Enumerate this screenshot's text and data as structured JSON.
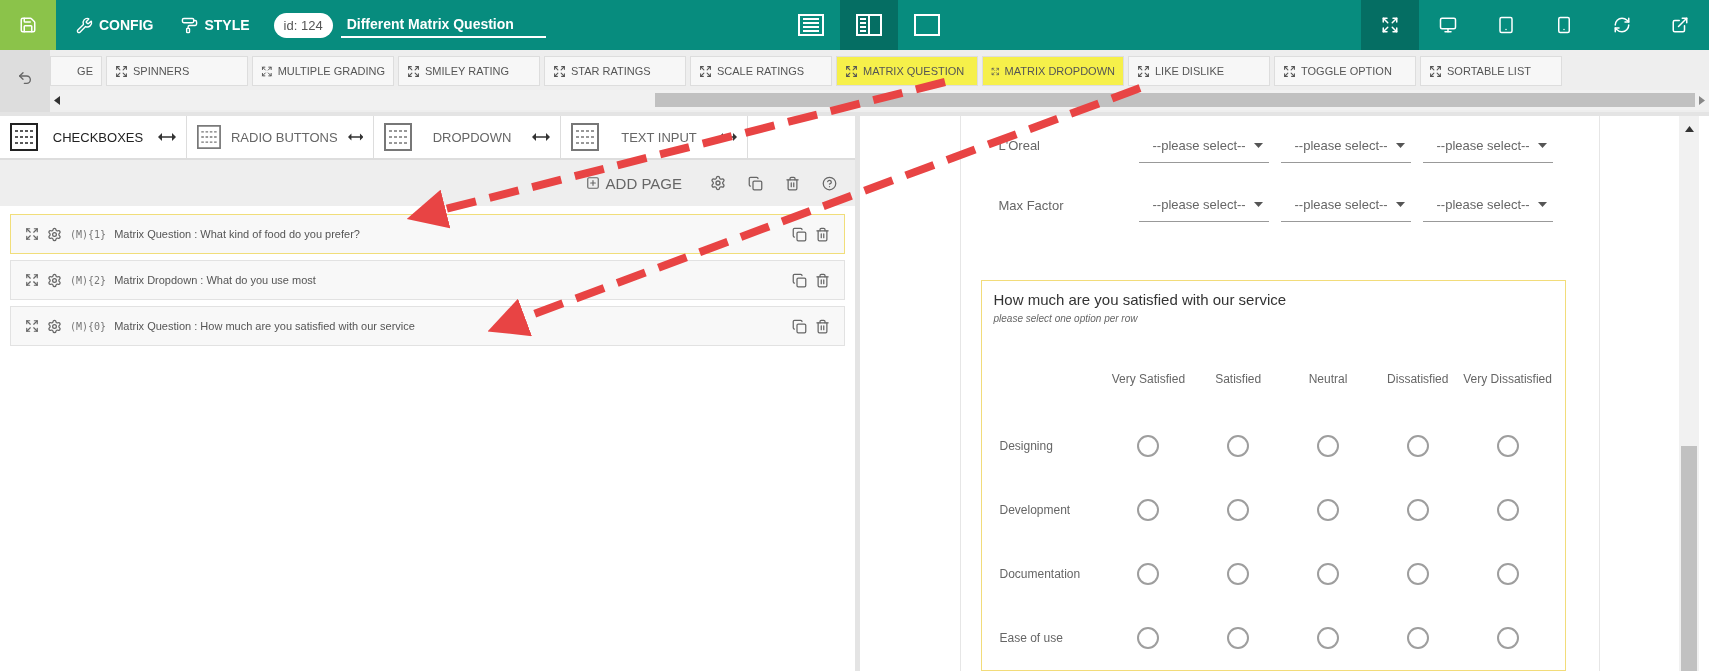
{
  "topbar": {
    "config": "CONFIG",
    "style": "STYLE",
    "id_badge": "id: 124",
    "title_value": "Different Matrix Question",
    "view_modes": [
      {
        "kind": "list",
        "selected": false
      },
      {
        "kind": "split",
        "selected": true
      },
      {
        "kind": "preview",
        "selected": false
      }
    ],
    "device_modes": [
      {
        "kind": "fullscreen",
        "selected": true
      },
      {
        "kind": "desktop",
        "selected": false
      },
      {
        "kind": "tablet",
        "selected": false
      },
      {
        "kind": "phone",
        "selected": false
      }
    ]
  },
  "palette": {
    "items": [
      {
        "label": "GE",
        "highlighted": false
      },
      {
        "label": "SPINNERS",
        "highlighted": false
      },
      {
        "label": "MULTIPLE GRADING",
        "highlighted": false
      },
      {
        "label": "SMILEY RATING",
        "highlighted": false
      },
      {
        "label": "STAR RATINGS",
        "highlighted": false
      },
      {
        "label": "SCALE RATINGS",
        "highlighted": false
      },
      {
        "label": "MATRIX QUESTION",
        "highlighted": true
      },
      {
        "label": "MATRIX DROPDOWN",
        "highlighted": true
      },
      {
        "label": "LIKE DISLIKE",
        "highlighted": false
      },
      {
        "label": "TOGGLE OPTION",
        "highlighted": false
      },
      {
        "label": "SORTABLE LIST",
        "highlighted": false
      }
    ]
  },
  "builder_tabs": [
    {
      "label": "CHECKBOXES",
      "selected": true
    },
    {
      "label": "RADIO BUTTONS",
      "selected": false
    },
    {
      "label": "DROPDOWN",
      "selected": false
    },
    {
      "label": "TEXT INPUT",
      "selected": false
    }
  ],
  "page_toolbar": {
    "add_page": "ADD PAGE"
  },
  "questions": [
    {
      "code": "(M){1}",
      "text": "Matrix Question : What kind of food do you prefer?",
      "selected": true
    },
    {
      "code": "(M){2}",
      "text": "Matrix Dropdown : What do you use most",
      "selected": false
    },
    {
      "code": "(M){0}",
      "text": "Matrix Question : How much are you satisfied with our service",
      "selected": false
    }
  ],
  "preview": {
    "dropdown_rows": [
      {
        "label": "L'Oreal",
        "selects": [
          "--please select--",
          "--please select--",
          "--please select--"
        ]
      },
      {
        "label": "Max Factor",
        "selects": [
          "--please select--",
          "--please select--",
          "--please select--"
        ]
      }
    ],
    "matrix": {
      "title": "How much are you satisfied with our service",
      "hint": "please select one option per row",
      "columns": [
        "Very Satisfied",
        "Satisfied",
        "Neutral",
        "Dissatisfied",
        "Very Dissatisfied"
      ],
      "rows": [
        {
          "label": "Designing",
          "choices": [
            false,
            false,
            false,
            false,
            false
          ]
        },
        {
          "label": "Development",
          "choices": [
            false,
            false,
            false,
            false,
            false
          ]
        },
        {
          "label": "Documentation",
          "choices": [
            false,
            false,
            false,
            false,
            false
          ]
        },
        {
          "label": "Ease of use",
          "choices": [
            false,
            false,
            false,
            false,
            false
          ]
        }
      ]
    }
  }
}
